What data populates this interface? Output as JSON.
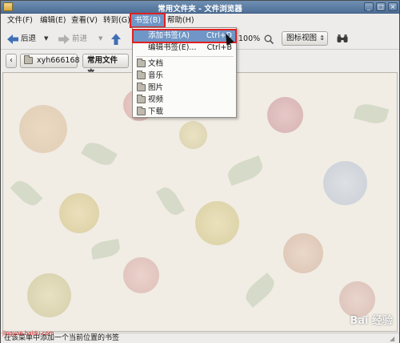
{
  "window": {
    "title": "常用文件夹 - 文件浏览器",
    "controls": [
      "_",
      "□",
      "×"
    ]
  },
  "menubar": {
    "items": [
      {
        "label": "文件(F)"
      },
      {
        "label": "编辑(E)"
      },
      {
        "label": "查看(V)"
      },
      {
        "label": "转到(G)"
      },
      {
        "label": "书签(B)",
        "active": true
      },
      {
        "label": "帮助(H)"
      }
    ]
  },
  "toolbar": {
    "back_label": "后退",
    "forward_label": "前进",
    "zoom_level": "100%",
    "view_mode": "图标视图"
  },
  "location": {
    "path_segments": [
      {
        "label": "xyh666168"
      },
      {
        "label": "常用文件夹"
      }
    ]
  },
  "bookmarks_menu": {
    "items": [
      {
        "label": "添加书签(A)",
        "accel": "Ctrl+D"
      },
      {
        "label": "编辑书签(E)...",
        "accel": "Ctrl+B"
      }
    ],
    "folders": [
      {
        "label": "文档"
      },
      {
        "label": "音乐"
      },
      {
        "label": "图片"
      },
      {
        "label": "视频"
      },
      {
        "label": "下载"
      }
    ]
  },
  "statusbar": {
    "text": "在该菜单中添加一个当前位置的书签"
  },
  "watermark": {
    "text": "Bai 经验",
    "sub": "jingyan.baidu.com"
  },
  "colors": {
    "highlight": "#6f96c6",
    "annotation_red": "#e02020",
    "titlebar": "#5a7aa0"
  }
}
